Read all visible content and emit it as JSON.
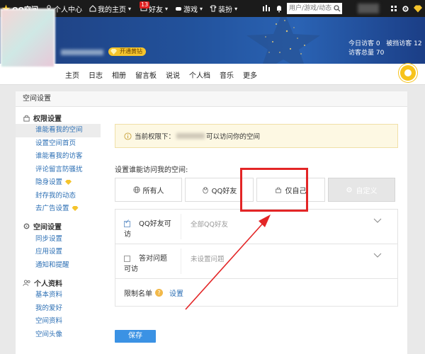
{
  "topbar": {
    "logo": "QQ空间",
    "items": [
      "个人中心",
      "我的主页",
      "好友",
      "游戏",
      "装扮"
    ],
    "friend_badge": "13",
    "search_placeholder": "用户/游戏/动态",
    "icons": [
      "star-logo-icon",
      "user-icon",
      "home-icon",
      "friends-icon",
      "gamepad-icon",
      "shirt-icon",
      "bars-icon",
      "search-icon",
      "notification-icon",
      "settings-icon",
      "diamond-icon"
    ]
  },
  "banner": {
    "vip_label": "开通黄钻",
    "today_visitors_label": "今日访客",
    "today_visitors": "0",
    "blocked_label": "被挡访客",
    "blocked": "12",
    "total_label": "访客总量",
    "total": "70"
  },
  "nav": [
    "主页",
    "日志",
    "相册",
    "留言板",
    "说说",
    "个人档",
    "音乐",
    "更多"
  ],
  "main": {
    "title": "空间设置",
    "sidebar": [
      {
        "heading": "权限设置",
        "icon": "lock-icon",
        "items": [
          {
            "label": "谁能看我的空间",
            "active": true
          },
          {
            "label": "设置空间首页"
          },
          {
            "label": "谁能看我的访客"
          },
          {
            "label": "评论留言防骚扰"
          },
          {
            "label": "隐身设置",
            "vip": true
          },
          {
            "label": "封存我的动态"
          },
          {
            "label": "去广告设置",
            "vip": true
          }
        ]
      },
      {
        "heading": "空间设置",
        "icon": "gear-icon",
        "items": [
          {
            "label": "同步设置"
          },
          {
            "label": "应用设置"
          },
          {
            "label": "通知和提醒"
          }
        ]
      },
      {
        "heading": "个人资料",
        "icon": "people-icon",
        "items": [
          {
            "label": "基本资料"
          },
          {
            "label": "我的爱好"
          },
          {
            "label": "空间资料"
          },
          {
            "label": "空间头像"
          }
        ]
      }
    ],
    "notice_prefix": "当前权限下：",
    "notice_suffix": "可以访问你的空间",
    "prompt": "设置谁能访问我的空间:",
    "options": [
      {
        "label": "所有人",
        "icon": "globe-icon"
      },
      {
        "label": "QQ好友",
        "icon": "qq-penguin-icon"
      },
      {
        "label": "仅自己",
        "icon": "lock-icon"
      },
      {
        "label": "自定义",
        "icon": "gear-icon"
      }
    ],
    "rows": [
      {
        "label": "QQ好友可访",
        "value": "全部QQ好友",
        "checked": true
      },
      {
        "label": "答对问题可访",
        "value": "未设置问题",
        "checked": false
      }
    ],
    "restrict_label": "限制名单",
    "restrict_link": "设置",
    "save": "保存"
  }
}
